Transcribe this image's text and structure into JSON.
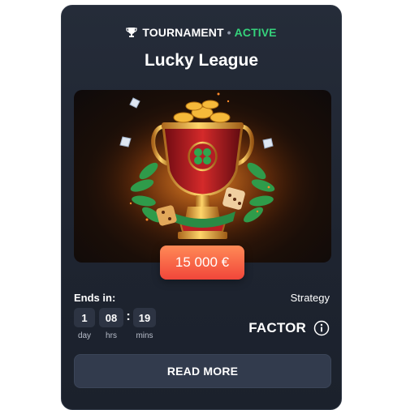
{
  "tournament": {
    "status_label": "TOURNAMENT",
    "status_separator": "•",
    "status_value": "ACTIVE",
    "title": "Lucky League",
    "prize": "15 000 €"
  },
  "countdown": {
    "label": "Ends in:",
    "days": "1",
    "days_label": "day",
    "hours": "08",
    "hours_label": "hrs",
    "separator": ":",
    "minutes": "19",
    "minutes_label": "mins"
  },
  "strategy": {
    "label": "Strategy",
    "value": "FACTOR"
  },
  "actions": {
    "read_more": "READ MORE"
  },
  "icons": {
    "status": "trophy-icon",
    "strategy_info": "info-icon"
  },
  "colors": {
    "card_bg": "#222834",
    "active": "#35d27b",
    "prize_gradient_top": "#ff8a56",
    "prize_gradient_bottom": "#f1463a",
    "button_bg": "#323b4d"
  }
}
